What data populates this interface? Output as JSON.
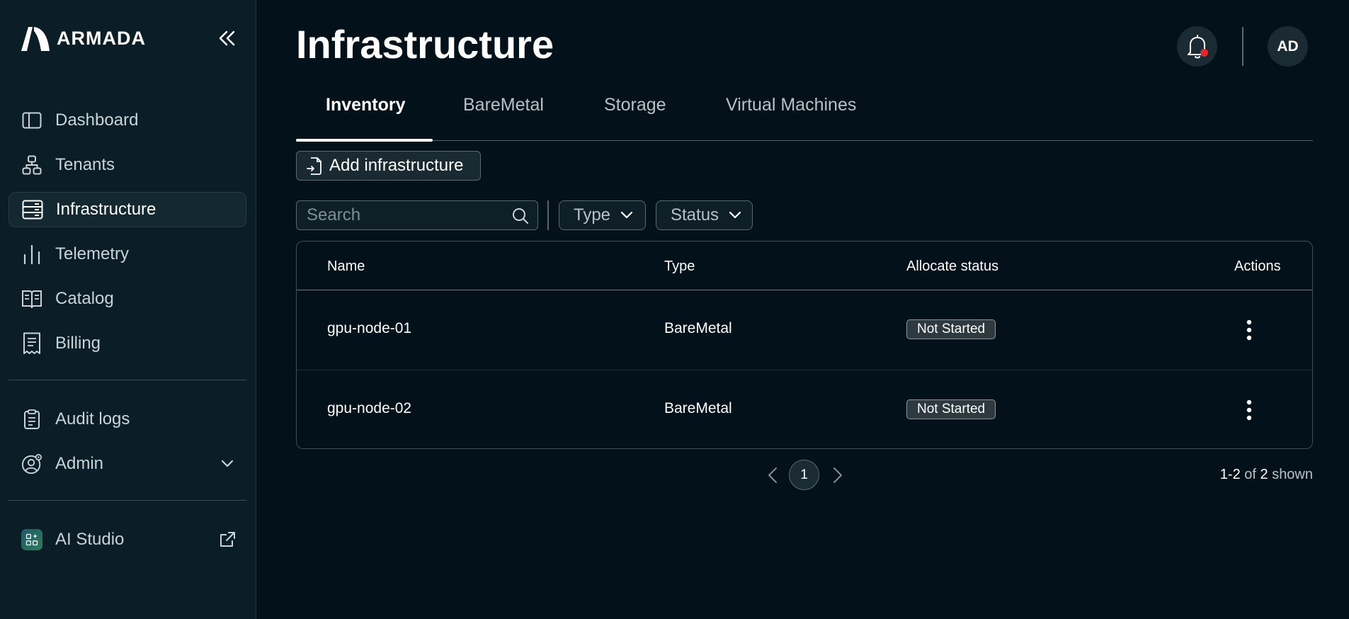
{
  "brand": {
    "name": "ARMADA"
  },
  "sidebar": {
    "items": [
      {
        "label": "Dashboard",
        "icon": "layout-icon"
      },
      {
        "label": "Tenants",
        "icon": "hierarchy-icon"
      },
      {
        "label": "Infrastructure",
        "icon": "server-icon",
        "active": true
      },
      {
        "label": "Telemetry",
        "icon": "bar-chart-icon"
      },
      {
        "label": "Catalog",
        "icon": "book-icon"
      },
      {
        "label": "Billing",
        "icon": "receipt-icon"
      },
      {
        "label": "Audit logs",
        "icon": "clipboard-icon"
      },
      {
        "label": "Admin",
        "icon": "user-gear-icon"
      },
      {
        "label": "AI Studio",
        "icon": "ai-studio-icon"
      }
    ]
  },
  "header": {
    "title": "Infrastructure",
    "avatar_initials": "AD"
  },
  "tabs": [
    {
      "label": "Inventory",
      "active": true
    },
    {
      "label": "BareMetal"
    },
    {
      "label": "Storage"
    },
    {
      "label": "Virtual Machines"
    }
  ],
  "toolbar": {
    "add_label": "Add infrastructure"
  },
  "filters": {
    "search_placeholder": "Search",
    "type_label": "Type",
    "status_label": "Status"
  },
  "table": {
    "headers": {
      "name": "Name",
      "type": "Type",
      "status": "Allocate status",
      "actions": "Actions"
    },
    "rows": [
      {
        "name": "gpu-node-01",
        "type": "BareMetal",
        "status": "Not Started"
      },
      {
        "name": "gpu-node-02",
        "type": "BareMetal",
        "status": "Not Started"
      }
    ]
  },
  "pagination": {
    "current": "1",
    "range": "1-2",
    "of": "of",
    "total": "2",
    "shown": "shown"
  },
  "colors": {
    "background": "#03121a",
    "sidebar": "#0b1d26",
    "notification_dot": "#e0282e"
  }
}
